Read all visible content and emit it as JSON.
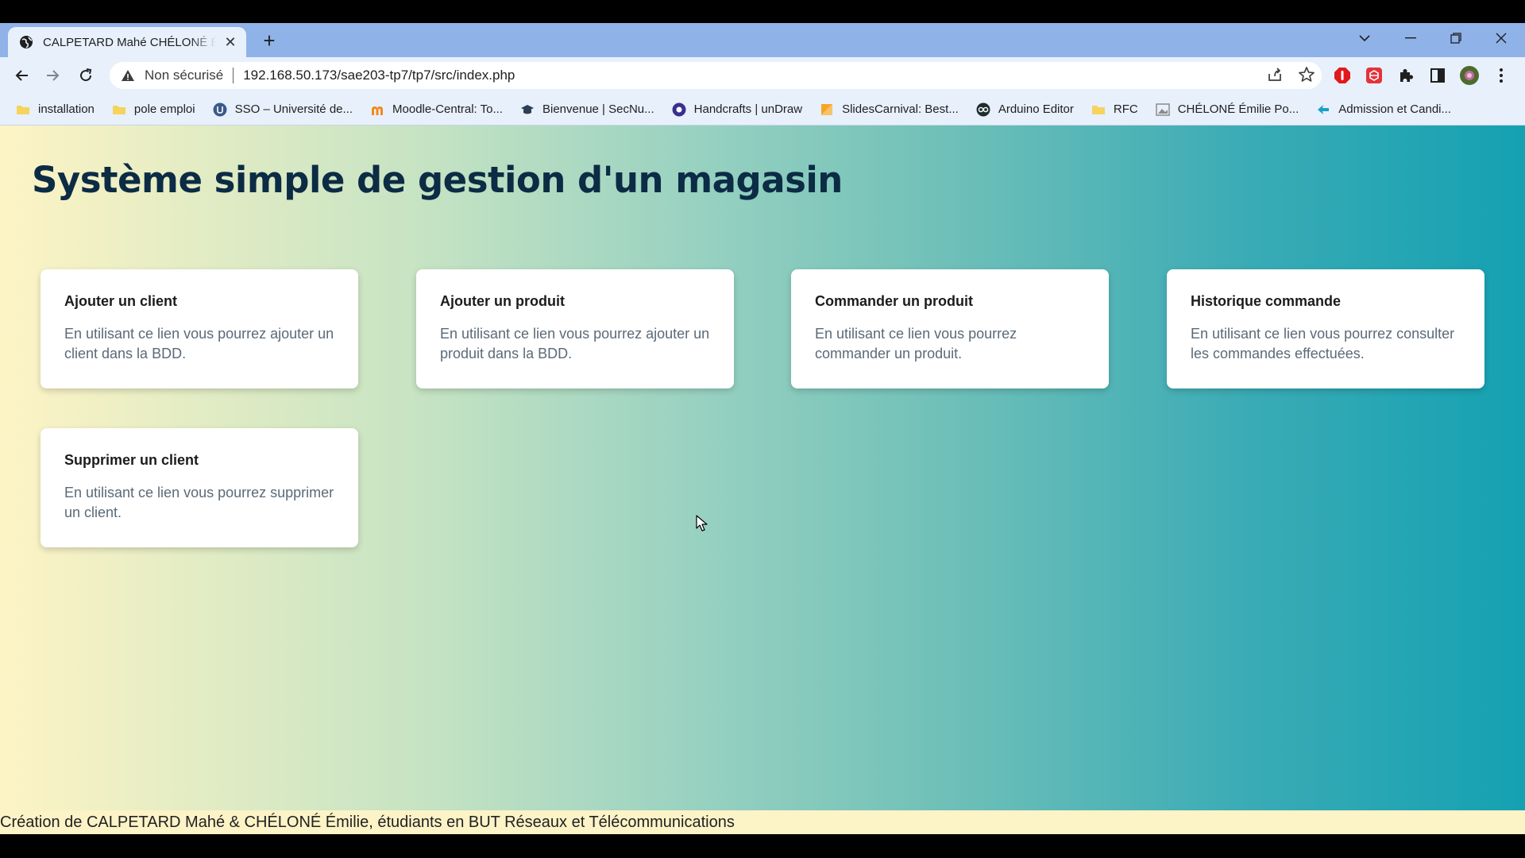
{
  "browser": {
    "tab_title": "CALPETARD Mahé CHÉLONÉ Émilie",
    "address": {
      "security_status": "Non sécurisé",
      "url": "192.168.50.173/sae203-tp7/tp7/src/index.php"
    },
    "bookmarks": [
      {
        "label": "installation",
        "icon": "folder-icon",
        "color": "#f6d35b"
      },
      {
        "label": "pole emploi",
        "icon": "folder-icon",
        "color": "#f6d35b"
      },
      {
        "label": "SSO – Université de...",
        "icon": "university-icon",
        "color": "#3b5a8c"
      },
      {
        "label": "Moodle-Central: To...",
        "icon": "moodle-icon",
        "color": "#f08a1d"
      },
      {
        "label": "Bienvenue | SecNu...",
        "icon": "graduation-cap-icon",
        "color": "#2d3e57"
      },
      {
        "label": "Handcrafts | unDraw",
        "icon": "undraw-icon",
        "color": "#3a2f8f"
      },
      {
        "label": "SlidesCarnival: Best...",
        "icon": "slides-icon",
        "color": "#f5a623"
      },
      {
        "label": "Arduino Editor",
        "icon": "arduino-icon",
        "color": "#1f2d2d"
      },
      {
        "label": "RFC",
        "icon": "folder-icon",
        "color": "#f6d35b"
      },
      {
        "label": "CHÉLONÉ Émilie Po...",
        "icon": "image-icon",
        "color": "#8a8a8a"
      },
      {
        "label": "Admission et Candi...",
        "icon": "admission-icon",
        "color": "#1aa0c8"
      }
    ]
  },
  "page": {
    "title": "Système simple de gestion d'un magasin",
    "cards": [
      {
        "title": "Ajouter un client",
        "text": "En utilisant ce lien vous pourrez ajouter un client dans la BDD."
      },
      {
        "title": "Ajouter un produit",
        "text": "En utilisant ce lien vous pourrez ajouter un produit dans la BDD."
      },
      {
        "title": "Commander un produit",
        "text": "En utilisant ce lien vous pourrez commander un produit."
      },
      {
        "title": "Historique commande",
        "text": "En utilisant ce lien vous pourrez consulter les commandes effectuées."
      },
      {
        "title": "Supprimer un client",
        "text": "En utilisant ce lien vous pourrez supprimer un client."
      }
    ],
    "footer": "Création de CALPETARD Mahé & CHÉLONÉ Émilie, étudiants en BUT Réseaux et Télécommunications"
  }
}
